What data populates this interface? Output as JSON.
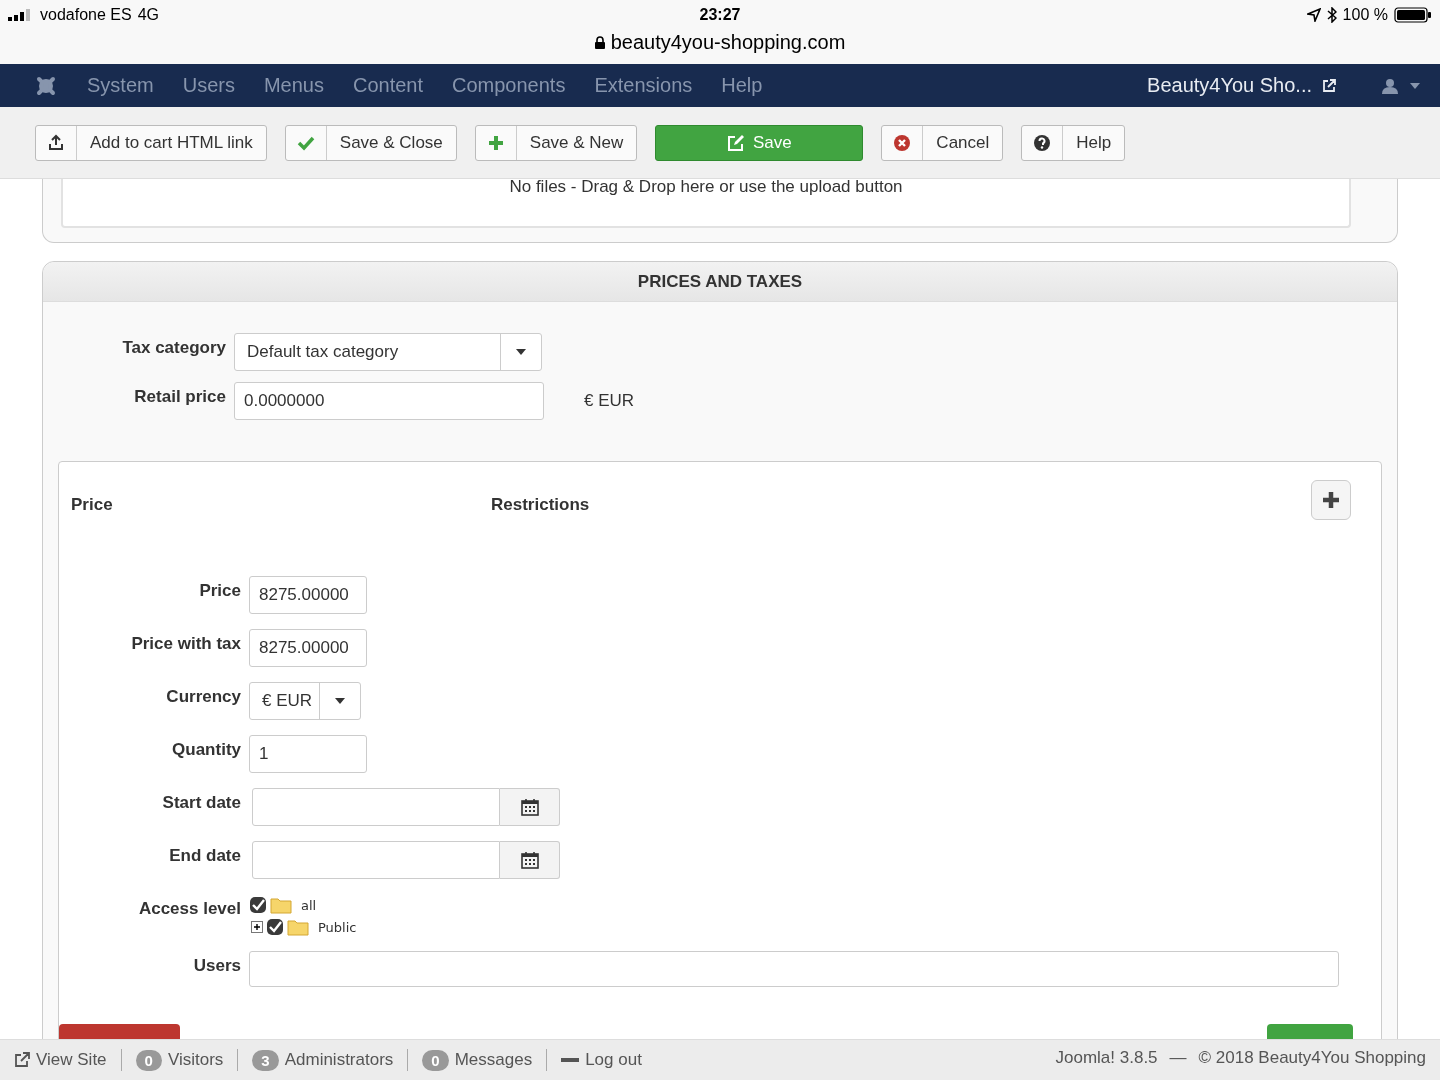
{
  "status_bar": {
    "carrier": "vodafone ES",
    "network": "4G",
    "time": "23:27",
    "battery": "100 %",
    "url": "beauty4you-shopping.com"
  },
  "nav": {
    "items": [
      "System",
      "Users",
      "Menus",
      "Content",
      "Components",
      "Extensions",
      "Help"
    ],
    "site_link": "Beauty4You Sho..."
  },
  "toolbar": {
    "buttons": [
      {
        "label": "Add to cart HTML link",
        "kind": "upload"
      },
      {
        "label": "Save & Close",
        "kind": "check"
      },
      {
        "label": "Save & New",
        "kind": "plus"
      },
      {
        "label": "Save",
        "kind": "primary"
      },
      {
        "label": "Cancel",
        "kind": "cancel"
      },
      {
        "label": "Help",
        "kind": "help"
      }
    ]
  },
  "upload": {
    "message": "No files - Drag & Drop here or use the upload button"
  },
  "prices_panel": {
    "title": "PRICES AND TAXES",
    "tax_category": {
      "label": "Tax category",
      "value": "Default tax category"
    },
    "retail_price": {
      "label": "Retail price",
      "value": "0.0000000",
      "currency": "€ EUR"
    },
    "price_table": {
      "headers": [
        "Price",
        "Restrictions"
      ],
      "fields": [
        {
          "kind": "text",
          "label": "Price",
          "value": "8275.00000"
        },
        {
          "kind": "text",
          "label": "Price with tax",
          "value": "8275.00000"
        },
        {
          "kind": "select",
          "label": "Currency",
          "value": "€ EUR"
        },
        {
          "kind": "text",
          "label": "Quantity",
          "value": "1"
        },
        {
          "kind": "date",
          "label": "Start date"
        },
        {
          "kind": "date",
          "label": "End date"
        },
        {
          "kind": "tree",
          "label": "Access level",
          "tree": [
            {
              "label": "all",
              "checked": true,
              "children": [
                {
                  "label": "Public",
                  "checked": true,
                  "expanded": false
                }
              ]
            }
          ]
        },
        {
          "kind": "wide",
          "label": "Users"
        }
      ]
    }
  },
  "footer": {
    "links": [
      {
        "kind": "link",
        "label": "View Site"
      },
      {
        "kind": "count",
        "count": "0",
        "label": "Visitors"
      },
      {
        "kind": "count",
        "count": "3",
        "label": "Administrators"
      },
      {
        "kind": "count",
        "count": "0",
        "label": "Messages"
      },
      {
        "kind": "logout",
        "label": "Log out"
      }
    ],
    "version": "Joomla! 3.8.5",
    "separator": "—",
    "copyright": "© 2018 Beauty4You Shopping"
  }
}
